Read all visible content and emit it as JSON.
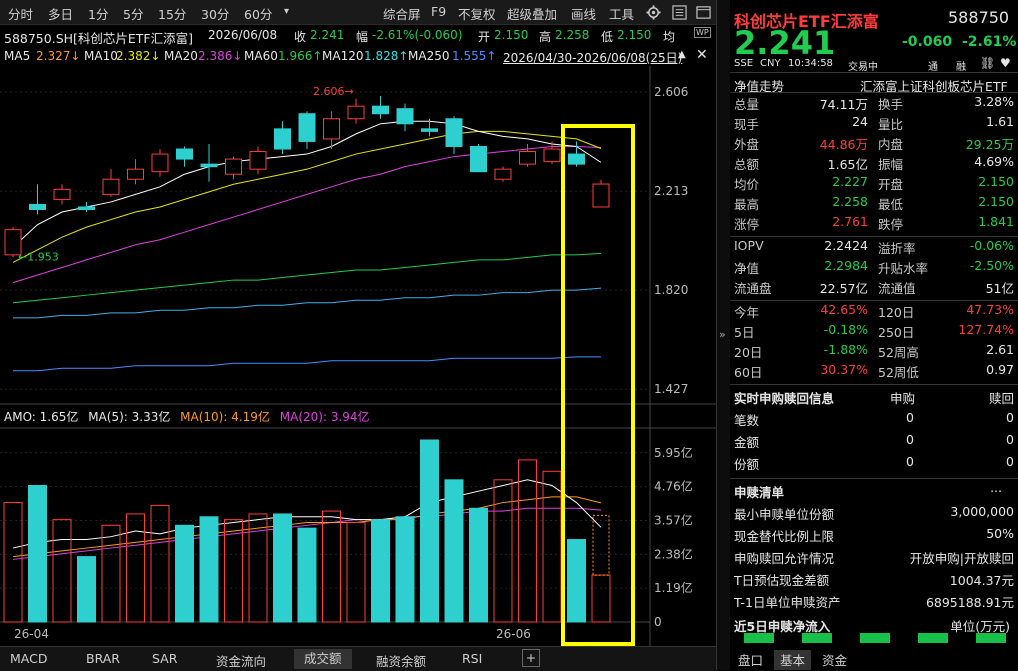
{
  "toolbar": {
    "periods": [
      "分时",
      "多日",
      "1分",
      "5分",
      "15分",
      "30分",
      "60分",
      "▾"
    ],
    "tools": [
      "综合屏",
      "F9",
      "不复权",
      "超级叠加",
      "画线",
      "工具"
    ],
    "gear_icon": "gear-icon",
    "list_icon": "list-icon",
    "window_icon": "window-icon"
  },
  "info": {
    "code_name": "588750.SH[科创芯片ETF汇添富]",
    "date": "2026/06/08",
    "close_label": "收",
    "close": "2.241",
    "change_label": "幅",
    "change": "-2.61%(-0.060)",
    "open_label": "开",
    "open": "2.150",
    "high_label": "高",
    "high": "2.258",
    "low_label": "低",
    "low": "2.150",
    "avg_label": "均",
    "wp": "WP"
  },
  "ma_line": {
    "ma5_label": "MA5",
    "ma5": "2.327↓",
    "ma10_label": "MA10",
    "ma10": "2.382↓",
    "ma20_label": "MA20",
    "ma20": "2.386↓",
    "ma60_label": "MA60",
    "ma60": "1.966↑",
    "ma120_label": "MA120",
    "ma120": "1.828↑",
    "ma250_label": "MA250",
    "ma250": "1.555↑",
    "range": "2026/04/30-2026/06/08(25日)"
  },
  "chart_labels": {
    "price_ticks": [
      "2.606",
      "2.213",
      "1.820",
      "1.427"
    ],
    "high_mark": "2.606",
    "low_mark": "1.953",
    "vol_ticks": [
      "5.95亿",
      "4.76亿",
      "3.57亿",
      "2.38亿",
      "1.19亿",
      "0"
    ],
    "x_labels": [
      "26-04",
      "26-06"
    ],
    "amo_label": "AMO: 1.65亿",
    "amo_ma5": "MA(5): 3.33亿",
    "amo_ma10": "MA(10): 4.19亿",
    "amo_ma20": "MA(20): 3.94亿"
  },
  "colors": {
    "up": "#ff3c3c",
    "down": "#2dcfcf",
    "ma5": "#ffffff",
    "ma10": "#e6e600",
    "ma20": "#e040e0",
    "ma60": "#1fce4e",
    "ma120": "#4a8cff",
    "highlight": "#ffff00"
  },
  "chart_data": {
    "type": "candlestick",
    "price_axis": [
      1.427,
      2.606
    ],
    "candles": [
      {
        "o": 1.96,
        "c": 2.06,
        "h": 2.07,
        "l": 1.95
      },
      {
        "o": 2.16,
        "c": 2.14,
        "h": 2.24,
        "l": 2.12
      },
      {
        "o": 2.18,
        "c": 2.22,
        "h": 2.24,
        "l": 2.16
      },
      {
        "o": 2.15,
        "c": 2.14,
        "h": 2.17,
        "l": 2.13
      },
      {
        "o": 2.2,
        "c": 2.26,
        "h": 2.3,
        "l": 2.19
      },
      {
        "o": 2.26,
        "c": 2.3,
        "h": 2.34,
        "l": 2.24
      },
      {
        "o": 2.29,
        "c": 2.36,
        "h": 2.38,
        "l": 2.27
      },
      {
        "o": 2.38,
        "c": 2.34,
        "h": 2.39,
        "l": 2.31
      },
      {
        "o": 2.32,
        "c": 2.31,
        "h": 2.4,
        "l": 2.25
      },
      {
        "o": 2.28,
        "c": 2.34,
        "h": 2.35,
        "l": 2.26
      },
      {
        "o": 2.3,
        "c": 2.37,
        "h": 2.39,
        "l": 2.28
      },
      {
        "o": 2.46,
        "c": 2.38,
        "h": 2.49,
        "l": 2.36
      },
      {
        "o": 2.52,
        "c": 2.41,
        "h": 2.53,
        "l": 2.38
      },
      {
        "o": 2.42,
        "c": 2.5,
        "h": 2.53,
        "l": 2.38
      },
      {
        "o": 2.5,
        "c": 2.55,
        "h": 2.58,
        "l": 2.48
      },
      {
        "o": 2.55,
        "c": 2.52,
        "h": 2.59,
        "l": 2.5
      },
      {
        "o": 2.54,
        "c": 2.48,
        "h": 2.56,
        "l": 2.45
      },
      {
        "o": 2.46,
        "c": 2.45,
        "h": 2.5,
        "l": 2.43
      },
      {
        "o": 2.5,
        "c": 2.39,
        "h": 2.51,
        "l": 2.36
      },
      {
        "o": 2.39,
        "c": 2.29,
        "h": 2.4,
        "l": 2.29
      },
      {
        "o": 2.26,
        "c": 2.3,
        "h": 2.31,
        "l": 2.25
      },
      {
        "o": 2.32,
        "c": 2.37,
        "h": 2.4,
        "l": 2.31
      },
      {
        "o": 2.33,
        "c": 2.38,
        "h": 2.41,
        "l": 2.32
      },
      {
        "o": 2.36,
        "c": 2.32,
        "h": 2.41,
        "l": 2.31
      },
      {
        "o": 2.15,
        "c": 2.241,
        "h": 2.258,
        "l": 2.15
      }
    ],
    "ma5": [
      1.99,
      2.08,
      2.13,
      2.15,
      2.17,
      2.2,
      2.23,
      2.28,
      2.31,
      2.33,
      2.34,
      2.35,
      2.36,
      2.39,
      2.44,
      2.48,
      2.49,
      2.49,
      2.48,
      2.45,
      2.43,
      2.42,
      2.4,
      2.39,
      2.327
    ],
    "ma10": [
      1.93,
      1.98,
      2.03,
      2.07,
      2.1,
      2.13,
      2.15,
      2.18,
      2.21,
      2.24,
      2.26,
      2.28,
      2.3,
      2.33,
      2.36,
      2.38,
      2.4,
      2.42,
      2.44,
      2.45,
      2.45,
      2.44,
      2.43,
      2.42,
      2.382
    ],
    "ma20": [
      1.85,
      1.88,
      1.91,
      1.94,
      1.97,
      2.0,
      2.02,
      2.05,
      2.08,
      2.11,
      2.14,
      2.17,
      2.2,
      2.23,
      2.26,
      2.28,
      2.31,
      2.33,
      2.35,
      2.36,
      2.37,
      2.38,
      2.39,
      2.39,
      2.386
    ],
    "ma60": [
      1.77,
      1.78,
      1.79,
      1.8,
      1.81,
      1.82,
      1.83,
      1.84,
      1.85,
      1.86,
      1.86,
      1.87,
      1.88,
      1.89,
      1.9,
      1.9,
      1.91,
      1.92,
      1.93,
      1.94,
      1.94,
      1.95,
      1.96,
      1.96,
      1.966
    ],
    "ma120": [
      1.71,
      1.71,
      1.72,
      1.72,
      1.73,
      1.73,
      1.74,
      1.74,
      1.75,
      1.75,
      1.76,
      1.76,
      1.77,
      1.77,
      1.78,
      1.78,
      1.79,
      1.79,
      1.8,
      1.8,
      1.81,
      1.81,
      1.82,
      1.82,
      1.828
    ],
    "ma250": [
      1.5,
      1.5,
      1.51,
      1.51,
      1.51,
      1.52,
      1.52,
      1.52,
      1.52,
      1.53,
      1.53,
      1.53,
      1.53,
      1.54,
      1.54,
      1.54,
      1.54,
      1.54,
      1.55,
      1.55,
      1.55,
      1.55,
      1.55,
      1.555,
      1.555
    ],
    "volume_axis": [
      0,
      6.4
    ],
    "volume": [
      4.2,
      4.8,
      3.6,
      2.3,
      3.4,
      3.8,
      4.1,
      3.4,
      3.7,
      3.6,
      3.8,
      3.8,
      3.3,
      3.9,
      3.5,
      3.6,
      3.7,
      6.4,
      5.0,
      4.0,
      5.0,
      5.7,
      5.3,
      2.9,
      1.65
    ],
    "amo_ma5": [
      2.6,
      2.8,
      2.9,
      2.9,
      3.0,
      3.2,
      3.1,
      3.3,
      3.4,
      3.5,
      3.6,
      3.7,
      3.7,
      3.7,
      3.6,
      3.6,
      3.7,
      4.2,
      4.4,
      4.6,
      4.8,
      5.0,
      4.8,
      4.2,
      3.33
    ],
    "amo_ma10": [
      2.3,
      2.4,
      2.5,
      2.6,
      2.7,
      2.8,
      2.9,
      3.0,
      3.1,
      3.2,
      3.3,
      3.4,
      3.5,
      3.5,
      3.5,
      3.6,
      3.6,
      3.8,
      3.9,
      4.0,
      4.2,
      4.3,
      4.4,
      4.4,
      4.19
    ],
    "amo_ma20": [
      2.2,
      2.3,
      2.4,
      2.5,
      2.6,
      2.7,
      2.8,
      2.9,
      3.0,
      3.1,
      3.2,
      3.3,
      3.4,
      3.5,
      3.6,
      3.6,
      3.7,
      3.7,
      3.8,
      3.9,
      3.9,
      4.0,
      4.0,
      4.0,
      3.94
    ]
  },
  "right_panel": {
    "title": "科创芯片ETF汇添富",
    "code": "588750",
    "price": "2.241",
    "change": "-0.060",
    "change_pct": "-2.61%",
    "meta": [
      "SSE",
      "CNY",
      "10:34:58",
      "交易中"
    ],
    "tags": [
      "通",
      "融"
    ],
    "nav_label": "净值走势",
    "nav_name": "汇添富上证科创板芯片ETF",
    "stats": [
      [
        "总量",
        "74.11万",
        "换手",
        "3.28%"
      ],
      [
        "现手",
        "24",
        "量比",
        "1.61"
      ],
      [
        "外盘",
        "44.86万",
        "内盘",
        "29.25万"
      ],
      [
        "总额",
        "1.65亿",
        "振幅",
        "4.69%"
      ],
      [
        "均价",
        "2.227",
        "开盘",
        "2.150"
      ],
      [
        "最高",
        "2.258",
        "最低",
        "2.150"
      ],
      [
        "涨停",
        "2.761",
        "跌停",
        "1.841"
      ]
    ],
    "stats2": [
      [
        "IOPV",
        "2.2424",
        "溢折率",
        "-0.06%"
      ],
      [
        "净值",
        "2.2984",
        "升贴水率",
        "-2.50%"
      ],
      [
        "流通盘",
        "22.57亿",
        "流通值",
        "51亿"
      ]
    ],
    "perf": [
      [
        "今年",
        "42.65%",
        "120日",
        "47.73%"
      ],
      [
        "5日",
        "-0.18%",
        "250日",
        "127.74%"
      ],
      [
        "20日",
        "-1.88%",
        "52周高",
        "2.61"
      ],
      [
        "60日",
        "30.37%",
        "52周低",
        "0.97"
      ]
    ],
    "rt_title": "实时申购赎回信息",
    "rt_buy": "申购",
    "rt_sell": "赎回",
    "rt_rows": [
      [
        "笔数",
        "0",
        "0"
      ],
      [
        "金额",
        "0",
        "0"
      ],
      [
        "份额",
        "0",
        "0"
      ]
    ],
    "list_title": "申赎清单",
    "list_more": "...",
    "list_rows": [
      [
        "最小申赎单位份额",
        "3,000,000"
      ],
      [
        "现金替代比例上限",
        "50%"
      ],
      [
        "申购赎回允许情况",
        "开放申购|开放赎回"
      ],
      [
        "T日预估现金差额",
        "1004.37元"
      ],
      [
        "T-1日单位申赎资产",
        "6895188.91元"
      ]
    ],
    "flow_title": "近5日申赎净流入",
    "flow_unit": "单位(万元)",
    "bottom_tabs": [
      "盘口",
      "基本",
      "资金"
    ]
  },
  "bottom_tabs": [
    "MACD",
    "BRAR",
    "SAR",
    "资金流向",
    "成交额",
    "融资余额",
    "RSI",
    "+"
  ]
}
